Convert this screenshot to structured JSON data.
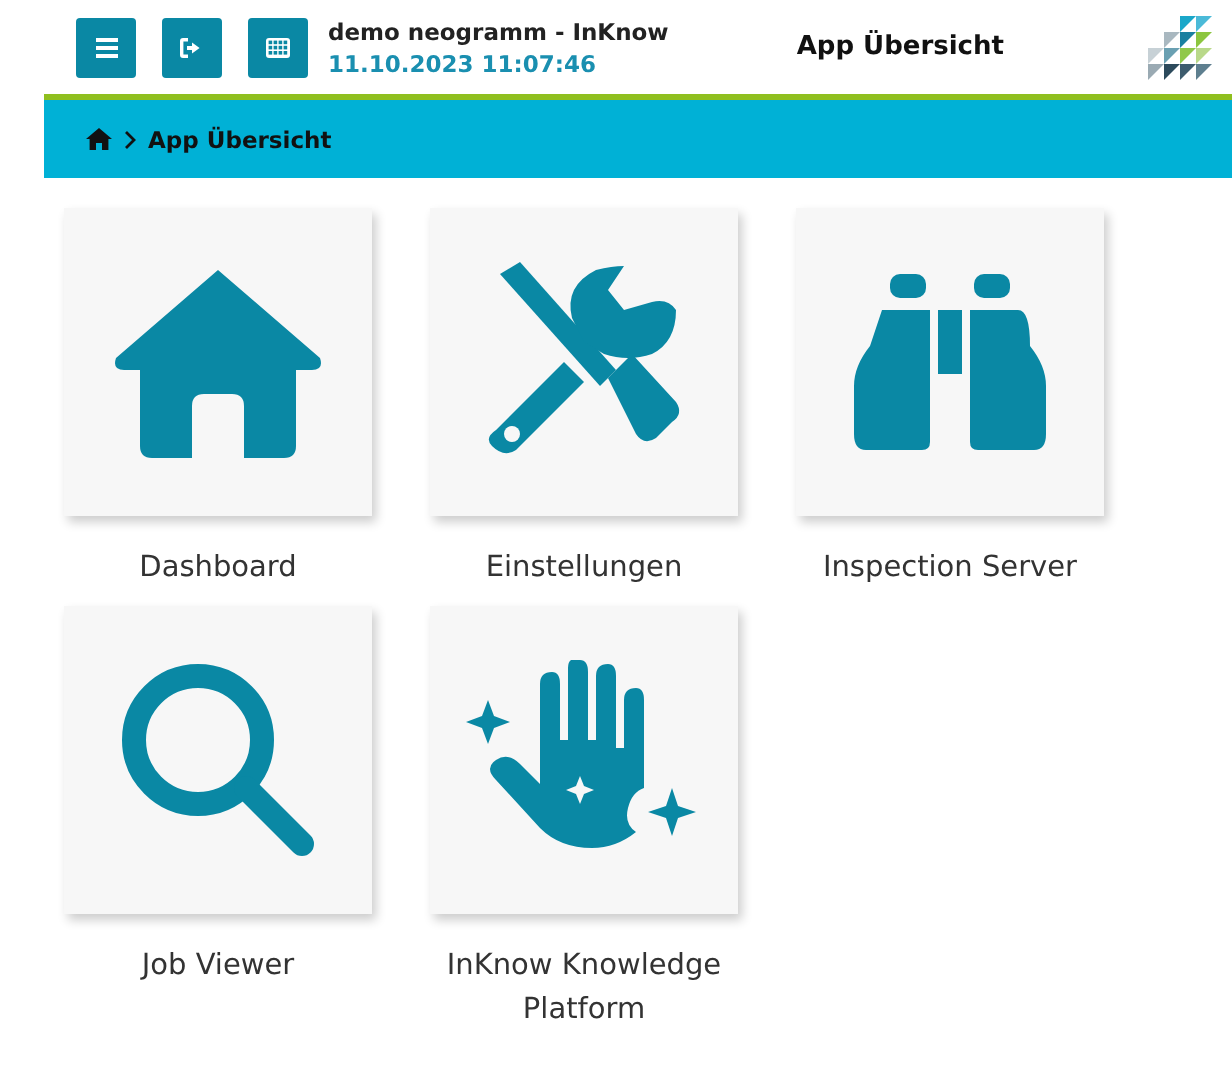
{
  "header": {
    "buttons": [
      {
        "kind": "menu"
      },
      {
        "kind": "logout"
      },
      {
        "kind": "grid"
      }
    ],
    "app_name": "demo neogramm - InKnow",
    "datetime": "11.10.2023 11:07:46",
    "title": "App Übersicht"
  },
  "breadcrumb": {
    "current": "App Übersicht"
  },
  "apps": [
    {
      "kind": "home",
      "label": "Dashboard"
    },
    {
      "kind": "tools",
      "label": "Einstellungen"
    },
    {
      "kind": "binoculars",
      "label": "Inspection Server"
    },
    {
      "kind": "search",
      "label": "Job Viewer"
    },
    {
      "kind": "hand",
      "label": "InKnow Knowledge Platform"
    }
  ]
}
